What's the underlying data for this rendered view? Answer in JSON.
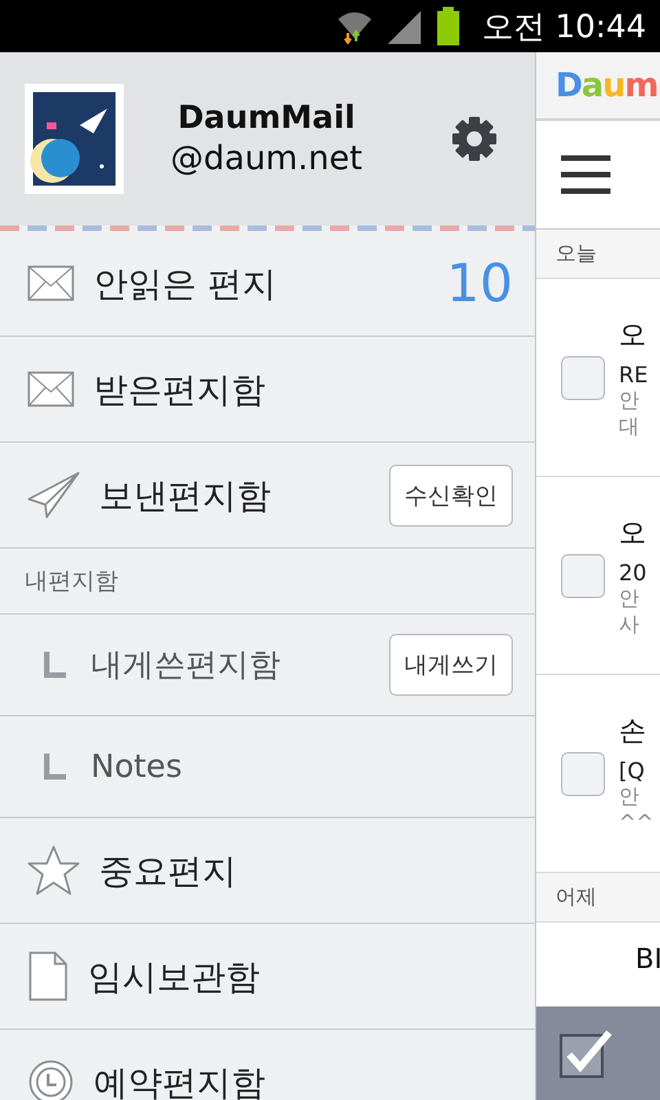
{
  "status_bar": {
    "time": "오전 10:44"
  },
  "drawer": {
    "account": {
      "name": "DaumMail",
      "domain": "@daum.net"
    },
    "items": [
      {
        "kind": "mail",
        "label": "안읽은 편지",
        "count": "10"
      },
      {
        "kind": "mail",
        "label": "받은편지함"
      },
      {
        "kind": "sent",
        "label": "보낸편지함",
        "button": "수신확인"
      },
      {
        "kind": "section",
        "label": "내편지함"
      },
      {
        "kind": "sub",
        "label": "내게쓴편지함",
        "button": "내게쓰기"
      },
      {
        "kind": "sub",
        "label": "Notes"
      },
      {
        "kind": "star",
        "label": "중요편지"
      },
      {
        "kind": "draft",
        "label": "임시보관함"
      },
      {
        "kind": "scheduled",
        "label": "예약편지함"
      }
    ]
  },
  "mail_panel": {
    "logo": [
      {
        "text": "D",
        "color": "#4a8fe6"
      },
      {
        "text": "a",
        "color": "#8cc63e"
      },
      {
        "text": "u",
        "color": "#f5b821"
      },
      {
        "text": "m",
        "color": "#f0685a"
      }
    ],
    "groups": [
      {
        "label": "오늘",
        "mails": [
          {
            "sender": "오",
            "subject": "RE",
            "preview": [
              "안",
              "대"
            ],
            "checked": false
          },
          {
            "sender": "오",
            "subject": "20",
            "preview": [
              "안",
              "사"
            ],
            "checked": false
          },
          {
            "sender": "손",
            "subject": "[Q",
            "preview": [
              "안",
              "^^"
            ],
            "checked": false
          }
        ]
      },
      {
        "label": "어제",
        "mails": [
          {
            "sender": "BI"
          }
        ]
      }
    ]
  }
}
